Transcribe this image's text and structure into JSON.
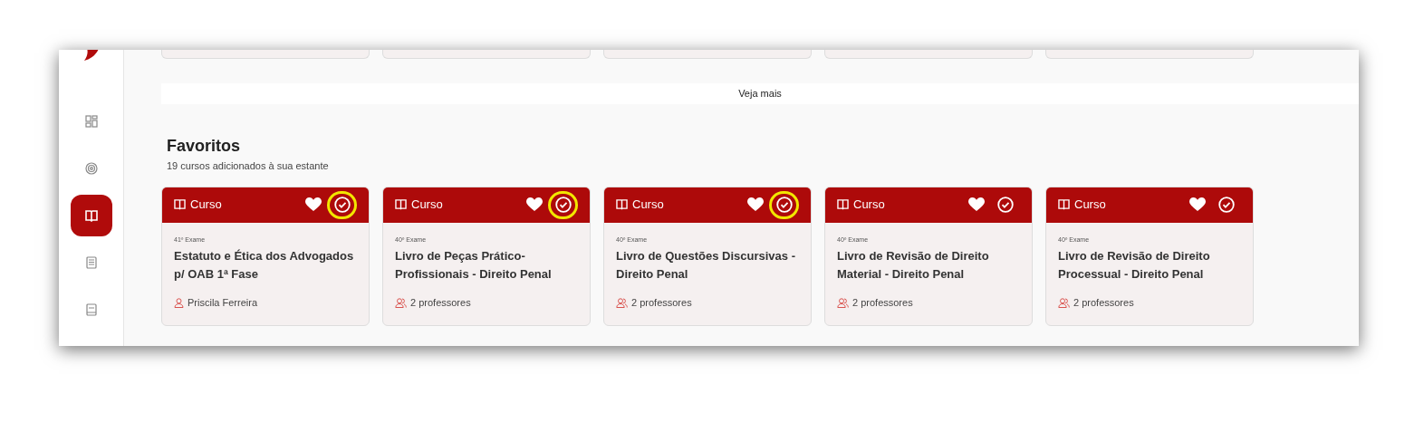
{
  "sidebar": {
    "items": [
      {
        "kind": "grid",
        "selected": false
      },
      {
        "kind": "target",
        "selected": false
      },
      {
        "kind": "book",
        "selected": true
      },
      {
        "kind": "notebook",
        "selected": false
      },
      {
        "kind": "tablet",
        "selected": false
      }
    ]
  },
  "see_more": "Veja mais",
  "favorites": {
    "title": "Favoritos",
    "subtitle": "19 cursos adicionados à sua estante",
    "cards": [
      {
        "type": "Curso",
        "exam": "41º Exame",
        "title": "Estatuto e Ética dos Advogados p/ OAB 1ª Fase",
        "teacher": "Priscila Ferreira",
        "kind": "single",
        "highlighted": true
      },
      {
        "type": "Curso",
        "exam": "40º Exame",
        "title": "Livro de Peças Prático-Profissionais - Direito Penal",
        "teacher": "2 professores",
        "kind": "group",
        "highlighted": true
      },
      {
        "type": "Curso",
        "exam": "40º Exame",
        "title": "Livro de Questões Discursivas - Direito Penal",
        "teacher": "2 professores",
        "kind": "group",
        "highlighted": true
      },
      {
        "type": "Curso",
        "exam": "40º Exame",
        "title": "Livro de Revisão de Direito Material - Direito Penal",
        "teacher": "2 professores",
        "kind": "group",
        "highlighted": false
      },
      {
        "type": "Curso",
        "exam": "40º Exame",
        "title": "Livro de Revisão de Direito Processual - Direito Penal",
        "teacher": "2 professores",
        "kind": "group",
        "highlighted": false
      }
    ]
  }
}
